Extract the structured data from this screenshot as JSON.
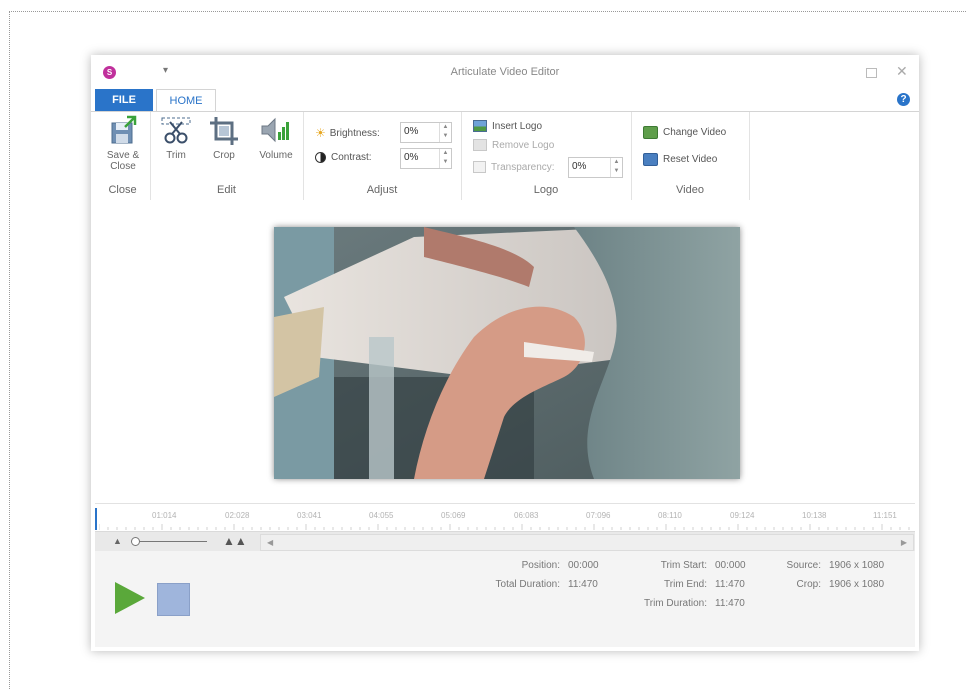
{
  "window": {
    "title": "Articulate Video Editor",
    "logo_text": "S"
  },
  "tabs": {
    "file": "FILE",
    "home": "HOME"
  },
  "ribbon": {
    "close_group": {
      "label": "Close",
      "save_close": "Save &\nClose"
    },
    "edit_group": {
      "label": "Edit",
      "trim": "Trim",
      "crop": "Crop",
      "volume": "Volume"
    },
    "adjust_group": {
      "label": "Adjust",
      "brightness_label": "Brightness:",
      "brightness_value": "0%",
      "contrast_label": "Contrast:",
      "contrast_value": "0%"
    },
    "logo_group": {
      "label": "Logo",
      "insert_logo": "Insert Logo",
      "remove_logo": "Remove Logo",
      "transparency_label": "Transparency:",
      "transparency_value": "0%"
    },
    "video_group": {
      "label": "Video",
      "change_video": "Change Video",
      "reset_video": "Reset Video"
    }
  },
  "timeline": {
    "labels": [
      "01:014",
      "02:028",
      "03:041",
      "04:055",
      "05:069",
      "06:083",
      "07:096",
      "08:110",
      "09:124",
      "10:138",
      "11:151"
    ]
  },
  "info": {
    "position_label": "Position:",
    "position_value": "00:000",
    "total_duration_label": "Total Duration:",
    "total_duration_value": "11:470",
    "trim_start_label": "Trim Start:",
    "trim_start_value": "00:000",
    "trim_end_label": "Trim End:",
    "trim_end_value": "11:470",
    "trim_duration_label": "Trim Duration:",
    "trim_duration_value": "11:470",
    "source_label": "Source:",
    "source_value": "1906 x 1080",
    "crop_label": "Crop:",
    "crop_value": "1906 x 1080"
  },
  "colors": {
    "accent": "#2a74c9",
    "play": "#5aa83a",
    "stop": "#9fb5dc"
  }
}
